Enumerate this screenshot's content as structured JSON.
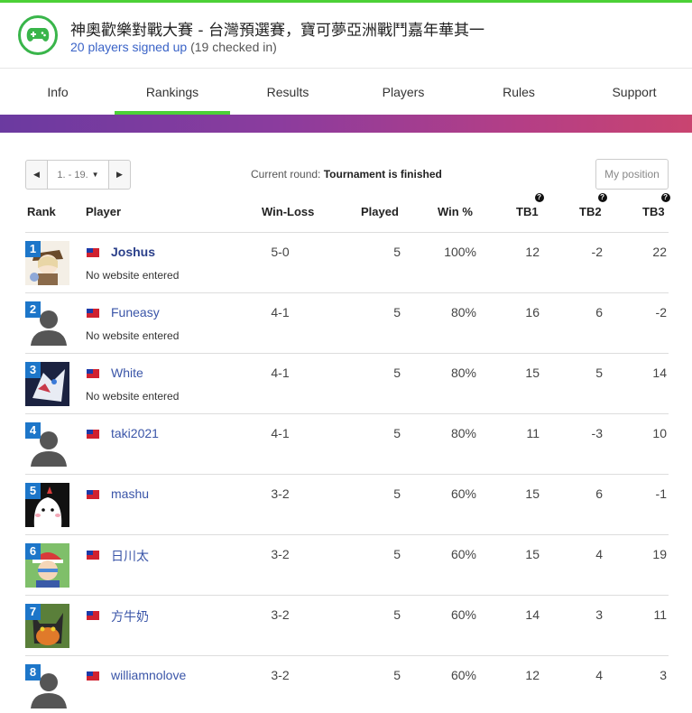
{
  "header": {
    "title": "神奧歡樂對戰大賽 - 台灣預選賽，寶可夢亞洲戰鬥嘉年華其一",
    "signup_text": "20 players signed up",
    "checked_in_text": "(19 checked in)",
    "icon": "gamepad-icon",
    "accent_color": "#39b54a"
  },
  "tabs": [
    {
      "label": "Info"
    },
    {
      "label": "Rankings",
      "active": true
    },
    {
      "label": "Results"
    },
    {
      "label": "Players"
    },
    {
      "label": "Rules"
    },
    {
      "label": "Support"
    }
  ],
  "pager": {
    "prev_icon": "chevron-left-icon",
    "next_icon": "chevron-right-icon",
    "selected": "1. - 19."
  },
  "round": {
    "label": "Current round:",
    "value": "Tournament is finished"
  },
  "my_position_label": "My position",
  "table": {
    "columns": {
      "rank": "Rank",
      "player": "Player",
      "win_loss": "Win-Loss",
      "played": "Played",
      "win_pct": "Win %",
      "tb1": "TB1",
      "tb2": "TB2",
      "tb3": "TB3"
    },
    "rows": [
      {
        "rank": "1",
        "name": "Joshus",
        "website": "No website entered",
        "win_loss": "5-0",
        "played": "5",
        "win_pct": "100%",
        "tb1": "12",
        "tb2": "-2",
        "tb3": "22"
      },
      {
        "rank": "2",
        "name": "Funeasy",
        "website": "No website entered",
        "win_loss": "4-1",
        "played": "5",
        "win_pct": "80%",
        "tb1": "16",
        "tb2": "6",
        "tb3": "-2"
      },
      {
        "rank": "3",
        "name": "White",
        "website": "No website entered",
        "win_loss": "4-1",
        "played": "5",
        "win_pct": "80%",
        "tb1": "15",
        "tb2": "5",
        "tb3": "14"
      },
      {
        "rank": "4",
        "name": "taki2021",
        "website": "",
        "win_loss": "4-1",
        "played": "5",
        "win_pct": "80%",
        "tb1": "11",
        "tb2": "-3",
        "tb3": "10"
      },
      {
        "rank": "5",
        "name": "mashu",
        "website": "",
        "win_loss": "3-2",
        "played": "5",
        "win_pct": "60%",
        "tb1": "15",
        "tb2": "6",
        "tb3": "-1"
      },
      {
        "rank": "6",
        "name": "日川太",
        "website": "",
        "win_loss": "3-2",
        "played": "5",
        "win_pct": "60%",
        "tb1": "15",
        "tb2": "4",
        "tb3": "19"
      },
      {
        "rank": "7",
        "name": "方牛奶",
        "website": "",
        "win_loss": "3-2",
        "played": "5",
        "win_pct": "60%",
        "tb1": "14",
        "tb2": "3",
        "tb3": "11"
      },
      {
        "rank": "8",
        "name": "williamnolove",
        "website": "",
        "win_loss": "3-2",
        "played": "5",
        "win_pct": "60%",
        "tb1": "12",
        "tb2": "4",
        "tb3": "3"
      }
    ]
  }
}
